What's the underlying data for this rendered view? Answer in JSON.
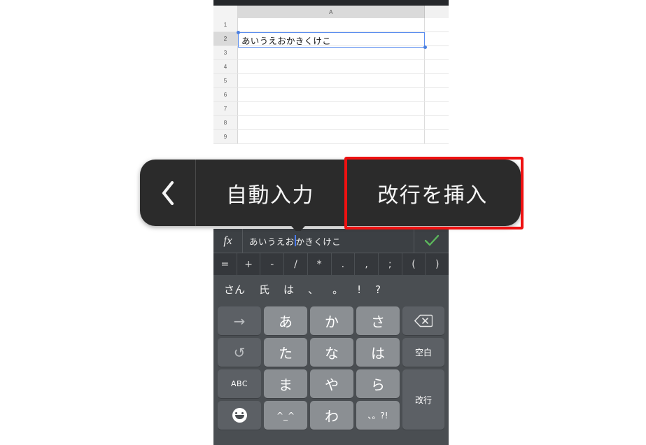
{
  "spreadsheet": {
    "columns": [
      "A",
      ""
    ],
    "rows": [
      "1",
      "2",
      "3",
      "4",
      "5",
      "6",
      "7",
      "8",
      "9"
    ],
    "selected_cell": "A2",
    "cell_value": "あいうえおかきくけこ"
  },
  "context_toolbar": {
    "back_icon": "chevron-left-icon",
    "items": [
      {
        "label": "自動入力",
        "highlighted": false
      },
      {
        "label": "改行を挿入",
        "highlighted": true
      }
    ],
    "highlight_color": "#ee1111"
  },
  "formula_bar": {
    "fx_label": "fx",
    "text_before_caret": "あいうえお",
    "text_after_caret": "かきくけこ",
    "confirm_icon": "check-icon",
    "confirm_color": "#5cb85c"
  },
  "symbol_row": {
    "keys": [
      "=",
      "+",
      "-",
      "/",
      "*",
      ".",
      ",",
      ";",
      "(",
      ")"
    ]
  },
  "suggestion_row": {
    "items": [
      "さん",
      "氏",
      "は",
      "、",
      "。",
      "!",
      "?"
    ]
  },
  "keyboard": {
    "row1": [
      {
        "label": "→",
        "name": "cursor-right-key",
        "type": "fn"
      },
      {
        "label": "あ",
        "name": "kana-a-key",
        "type": "kana"
      },
      {
        "label": "か",
        "name": "kana-ka-key",
        "type": "kana"
      },
      {
        "label": "さ",
        "name": "kana-sa-key",
        "type": "kana"
      },
      {
        "label": "⌫",
        "name": "backspace-key",
        "type": "fn"
      }
    ],
    "row2": [
      {
        "label": "↺",
        "name": "undo-key",
        "type": "fn"
      },
      {
        "label": "た",
        "name": "kana-ta-key",
        "type": "kana"
      },
      {
        "label": "な",
        "name": "kana-na-key",
        "type": "kana"
      },
      {
        "label": "は",
        "name": "kana-ha-key",
        "type": "kana"
      },
      {
        "label": "空白",
        "name": "space-key",
        "type": "fn"
      }
    ],
    "row3": [
      {
        "label": "ABC",
        "name": "abc-mode-key",
        "type": "fn"
      },
      {
        "label": "ま",
        "name": "kana-ma-key",
        "type": "kana"
      },
      {
        "label": "や",
        "name": "kana-ya-key",
        "type": "kana"
      },
      {
        "label": "ら",
        "name": "kana-ra-key",
        "type": "kana"
      }
    ],
    "row4": [
      {
        "label": "",
        "name": "emoji-key",
        "type": "fn"
      },
      {
        "label": "^_^",
        "name": "kaomoji-key",
        "type": "kana"
      },
      {
        "label": "わ",
        "name": "kana-wa-key",
        "type": "kana"
      },
      {
        "label": "、。?!",
        "name": "punctuation-key",
        "type": "kana"
      }
    ],
    "enter_key": {
      "label": "改行",
      "name": "enter-newline-key"
    }
  }
}
